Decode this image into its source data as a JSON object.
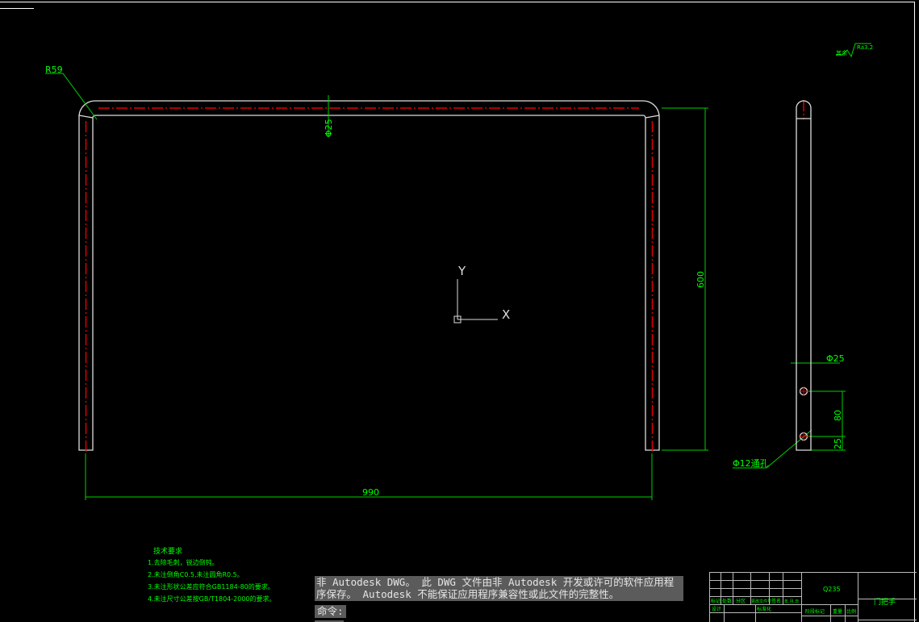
{
  "drawing": {
    "dim_radius": "R59",
    "dim_tube_dia": "Φ25",
    "dim_width": "990",
    "dim_height": "600",
    "side_dia": "Φ25",
    "side_hole_spacing": "80",
    "side_hole_offset": "25",
    "hole_label": "Φ12通孔",
    "roughness_prefix": "其余",
    "roughness_value": "Ra3.2",
    "ucs_x": "X",
    "ucs_y": "Y"
  },
  "tech_requirements": {
    "title": "技术要求",
    "items": [
      "1.去除毛刺，锐边倒钝。",
      "2.未注倒角C0.5,未注圆角R0.5。",
      "3.未注形状公差应符合GB1184-80的要求。",
      "4.未注尺寸公差按GB/T1804-2000的要求。"
    ]
  },
  "title_block": {
    "material": "Q235",
    "part_name": "门把手",
    "headers": [
      "标记",
      "处数",
      "分区",
      "更改文件号",
      "签名",
      "年.月.日"
    ],
    "design": "设计",
    "standard": "标准化",
    "stage": "阶段标记",
    "weight": "重量",
    "scale": "比例"
  },
  "command": {
    "warning": "非 Autodesk DWG。  此 DWG 文件由非 Autodesk 开发或许可的软件应用程序保存。  Autodesk 不能保证应用程序兼容性或此文件的完整性。",
    "prompt": "命令:"
  },
  "colors": {
    "geometry": "#ffffff",
    "dimension": "#00ff00",
    "centerline": "#ff0000"
  }
}
